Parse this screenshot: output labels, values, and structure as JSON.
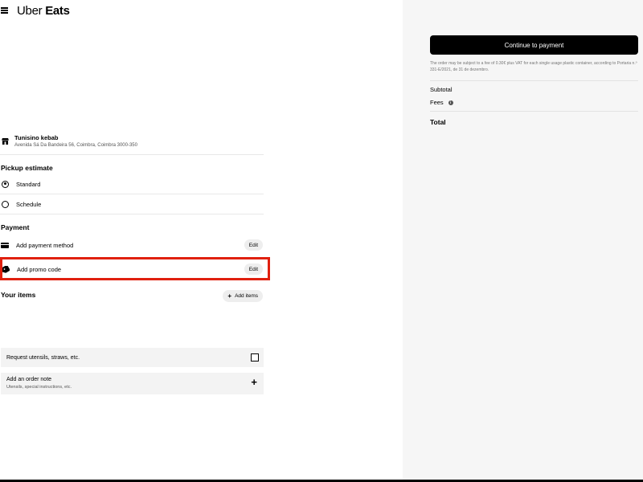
{
  "header": {
    "logo_brand": "Uber",
    "logo_product": "Eats"
  },
  "store": {
    "name": "Tunisino kebab",
    "address": "Avenida Sá Da Bandeira 56, Coimbra, Coimbra 3000-350"
  },
  "pickup": {
    "title": "Pickup estimate",
    "options": [
      {
        "label": "Standard",
        "selected": true
      },
      {
        "label": "Schedule",
        "selected": false
      }
    ]
  },
  "payment": {
    "title": "Payment",
    "method_label": "Add payment method",
    "method_edit": "Edit",
    "promo_label": "Add promo code",
    "promo_edit": "Edit"
  },
  "items": {
    "title": "Your items",
    "add_label": "Add items"
  },
  "utensils": {
    "label": "Request utensils, straws, etc."
  },
  "order_note": {
    "title": "Add an order note",
    "subtitle": "Utensils, special instructions, etc."
  },
  "summary": {
    "continue_label": "Continue to payment",
    "disclaimer": "The order may be subject to a fee of 0.30€ plus VAT for each single usage plastic container, according to Portaria n.º 331-E/2021, de 31 de dezembro.",
    "subtotal_label": "Subtotal",
    "fees_label": "Fees",
    "total_label": "Total"
  },
  "colors": {
    "highlight": "#e0200f",
    "panel_bg": "#f6f6f6",
    "button_bg": "#000000"
  }
}
